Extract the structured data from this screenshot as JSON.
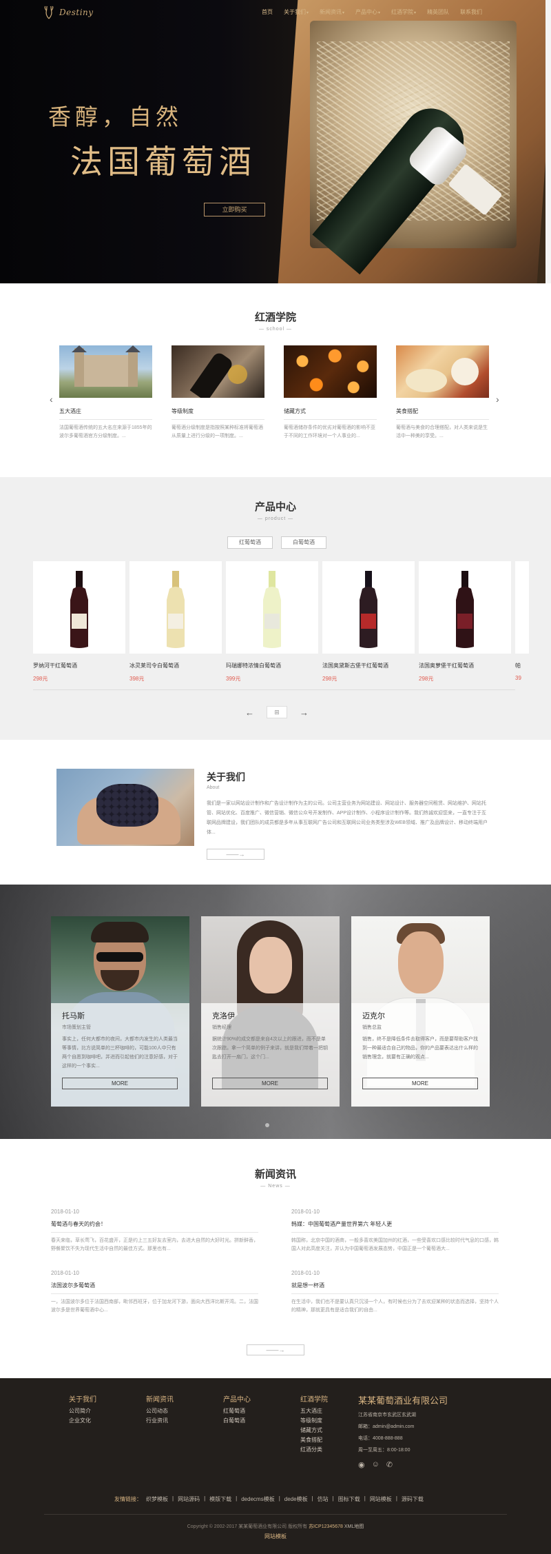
{
  "brand": {
    "logo_text": "Destiny",
    "accent": "#c9a876"
  },
  "nav": {
    "items": [
      {
        "label": "首页",
        "dropdown": false
      },
      {
        "label": "关于我们",
        "dropdown": true
      },
      {
        "label": "新闻资讯",
        "dropdown": true
      },
      {
        "label": "产品中心",
        "dropdown": true
      },
      {
        "label": "红酒学院",
        "dropdown": true
      },
      {
        "label": "精英团队",
        "dropdown": false
      },
      {
        "label": "联系我们",
        "dropdown": false
      }
    ]
  },
  "hero": {
    "tagline": "香醇，自然",
    "title": "法国葡萄酒",
    "button": "立即购买"
  },
  "academy": {
    "title": "红酒学院",
    "subtitle": "— school —",
    "items": [
      {
        "name": "五大酒庄",
        "desc": "法国葡萄酒传统的五大名庄来源于1855年的波尔多葡萄酒官方分级制度。..."
      },
      {
        "name": "等级制度",
        "desc": "葡萄酒分级制度是指按照某种标准将葡萄酒从质量上进行分级的一项制度。..."
      },
      {
        "name": "储藏方式",
        "desc": "葡萄酒储存条件的优劣对葡萄酒的影响不亚于不同的工作环境对一个人事业的..."
      },
      {
        "name": "美食搭配",
        "desc": "葡萄酒与美食的合理搭配，对人类来说是生活中一种美的享受。..."
      }
    ]
  },
  "products": {
    "title": "产品中心",
    "subtitle": "— product —",
    "tabs": [
      "红葡萄酒",
      "白葡萄酒"
    ],
    "items": [
      {
        "name": "罗纳河干红葡萄酒",
        "price": "298元"
      },
      {
        "name": "冰灵莱司令白葡萄酒",
        "price": "398元"
      },
      {
        "name": "玛瑞娜特浓情白葡萄酒",
        "price": "399元"
      },
      {
        "name": "法国奥黛斯古堡干红葡萄酒",
        "price": "298元"
      },
      {
        "name": "法国奥萝堡干红葡萄酒",
        "price": "298元"
      }
    ],
    "partial_name": "帕",
    "partial_price": "39",
    "grid_icon": "⊞",
    "prev": "←",
    "next": "→"
  },
  "about": {
    "title": "关于我们",
    "subtitle": "About",
    "text": "我们是一家以网站设计制作和广告设计制作为主的公司。公司主营业务为网站建设、网站设计、服务器空间租赁、网站维护、网站托管、网站优化、百度推广、微信营销、微信公众号开发制作、APP设计制作、小程序设计制作等。我们热诚欢迎您来，一直专注于互联网品牌建设，我们团队的成员都是多年从事互联网广告公司和互联网公司业务类型涉及WEB领域、推广及品牌设计、移动终端用户体...",
    "button": "——→"
  },
  "team": {
    "members": [
      {
        "name": "托马斯",
        "role": "市场策划主管",
        "desc": "事实上，任何大都市的夜间，大都市内发生的人类最当等事情，比方说简单的三杯咖啡的，可能100人中只有两个自愿到咖啡吧，并进而引起他们的注意好感，对于这样的一个事实...",
        "button": "MORE"
      },
      {
        "name": "克洛伊",
        "role": "销售经理",
        "desc": "据统计90%的成交都是来自4次以上的跟进，而不是单次跟踪。拿一个简单的例子来讲，就是我们带着一把钥匙去打开一扇门，这个门...",
        "button": "MORE"
      },
      {
        "name": "迈克尔",
        "role": "销售总监",
        "desc": "销售，终不是降低条件去取得客户，而是要帮助客户找到一种最适合自己的物品，你的产品要表达出什么样的销售理念，就要有正确的观点...",
        "button": "MORE"
      }
    ]
  },
  "news": {
    "title": "新闻资讯",
    "subtitle": "— News —",
    "items": [
      {
        "date": "2018-01-10",
        "title": "葡萄酒与春天的约会！",
        "desc": "春天来临，草长莺飞，百花盛开，正是约上三五好友去室内，去进大自然的大好时光。拼新鲜香，野餐聚饮不失为现代生活中自然的最佳方式。那里也有..."
      },
      {
        "date": "2018-01-10",
        "title": "韩媒：中国葡萄酒产量世界第六 年轻人更",
        "desc": "韩国称，北京中国的酒商，一般多喜欢美国加州的红酒，一些受喜欢口感比较时代气息的口感，韩国人对此高度关注，并认为中国葡萄酒发展态势，中国正是一个葡萄酒大..."
      },
      {
        "date": "2018-01-10",
        "title": "法国波尔多葡萄酒",
        "desc": "一，法国波尔多位于法国西南部，毗邻西班牙，位于加龙河下游，面向大西洋比斯开湾。二，法国波尔多是世界葡萄酒中心..."
      },
      {
        "date": "2018-01-10",
        "title": "就是想一杯酒",
        "desc": "在生活中，我们也不是要认真只沉浸一个人，有时候也分为了去欢迎某种的状态而选择，坚持个人的精神，那就更具有是适合我们的自由..."
      }
    ],
    "button": "——→"
  },
  "footer": {
    "columns": [
      {
        "head": "关于我们",
        "links": [
          "公司简介",
          "企业文化"
        ]
      },
      {
        "head": "新闻资讯",
        "links": [
          "公司动态",
          "行业资讯"
        ]
      },
      {
        "head": "产品中心",
        "links": [
          "红葡萄酒",
          "白葡萄酒"
        ]
      },
      {
        "head": "红酒学院",
        "links": [
          "五大酒庄",
          "等级制度",
          "储藏方式",
          "美食搭配",
          "红酒分类"
        ]
      }
    ],
    "company": {
      "name": "某某葡萄酒业有限公司",
      "address": "江苏省南京市玄武区玄武湖",
      "email": "邮箱：admin@admin.com",
      "phone": "电话：4008-888-888",
      "hours": "周一至周五：8:00-18:00"
    },
    "links_label": "友情链接：",
    "links": [
      "织梦模板",
      "网站源码",
      "模版下载",
      "dedecms模板",
      "dede模板",
      "仿站",
      "图标下载",
      "网站模板",
      "源码下载"
    ],
    "copyright": "Copyright © 2002-2017 某某葡萄酒业有限公司 版权所有",
    "icp": "苏ICP12345678",
    "xml_map": "XML地图",
    "site_template": "网站模板"
  }
}
